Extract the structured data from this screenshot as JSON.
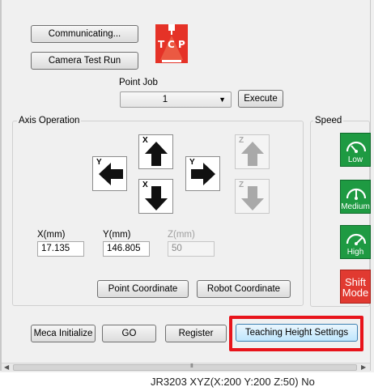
{
  "buttons": {
    "communicating": "Communicating...",
    "camera_test_run": "Camera Test Run",
    "execute": "Execute",
    "point_coordinate": "Point Coordinate",
    "robot_coordinate": "Robot Coordinate",
    "meca_initialize": "Meca Initialize",
    "go": "GO",
    "register": "Register",
    "teaching_height_settings": "Teaching Height Settings"
  },
  "logo": {
    "text": "TCP",
    "color": "#e53227"
  },
  "point_job": {
    "label": "Point Job",
    "selected": "1"
  },
  "axis_operation": {
    "label": "Axis Operation",
    "jog": {
      "x_plus": "X",
      "x_minus": "X",
      "y_minus": "Y",
      "y_plus": "Y",
      "z_plus": "Z",
      "z_minus": "Z"
    },
    "fields": {
      "x": {
        "label": "X(mm)",
        "value": "17.135"
      },
      "y": {
        "label": "Y(mm)",
        "value": "146.805"
      },
      "z": {
        "label": "Z(mm)",
        "value": "50"
      }
    }
  },
  "speed": {
    "label": "Speed",
    "low": "Low",
    "medium": "Medium",
    "high": "High",
    "shift_line1": "Shift",
    "shift_line2": "Mode",
    "color": "#1e9a42",
    "shift_color": "#e13a31"
  },
  "icons": [
    "left-arrow-icon",
    "up-arrow-icon",
    "down-arrow-icon",
    "right-arrow-icon",
    "speedometer-icon",
    "dropdown-caret-icon"
  ],
  "scrollbar": {
    "grip": "III"
  },
  "status_bar": {
    "text": "JR3203 XYZ(X:200 Y:200 Z:50) No"
  }
}
